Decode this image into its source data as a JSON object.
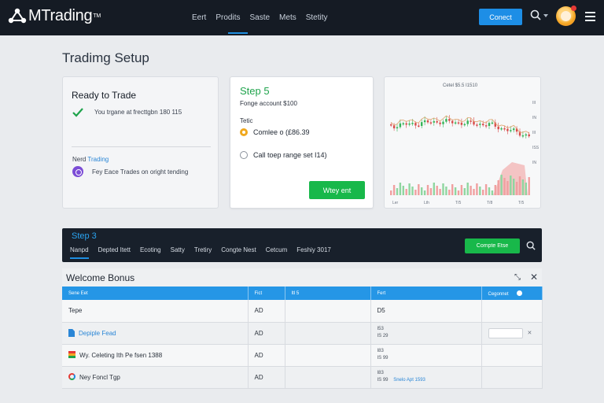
{
  "app": {
    "logo_text": "MTrading",
    "logo_tm": "TM",
    "nav": [
      {
        "label": "Eert",
        "active": false
      },
      {
        "label": "Prodits",
        "active": true
      },
      {
        "label": "Saste",
        "active": false
      },
      {
        "label": "Mets",
        "active": false
      },
      {
        "label": "Stetity",
        "active": false
      }
    ],
    "connect_label": "Conect",
    "accent": "#1d8ee6"
  },
  "page": {
    "title": "Tradimg Setup"
  },
  "ready_card": {
    "title": "Ready to Trade",
    "ready_text": "You trgane at frecttgbn 180 115",
    "next_prefix": "Nerd",
    "next_link": "Trading",
    "info_text": "Fey Eace Trades on oright tending"
  },
  "step5_card": {
    "step_label": "Step 5",
    "account_text": "Fonge account $100",
    "field_label": "Tetic",
    "option1": "Comlee o (£86.39",
    "option2": "Call toep range set I14)",
    "button_label": "Wtey ent",
    "color": "#1ea34b"
  },
  "chart_card": {
    "title": "Cetel $5.5 I1510"
  },
  "chart_data": {
    "type": "candlestick",
    "title": "Cetel $5.5 I1510",
    "x_tick_labels": [
      "Ler",
      "Lth",
      "T/5",
      "T/8",
      "T/5"
    ],
    "y_tick_labels": [
      "III",
      "IN",
      "III",
      "ISS",
      "IN"
    ],
    "colors": {
      "up": "#35b457",
      "down": "#d84b4b",
      "ma_line": "#e0a36c",
      "volume_up": "#8fd6a0",
      "volume_down": "#f0a0a0"
    }
  },
  "step3_bar": {
    "step_label": "Step 3",
    "tabs": [
      {
        "label": "Nanpd",
        "active": true
      },
      {
        "label": "Depted Itett",
        "active": false
      },
      {
        "label": "Ecoting",
        "active": false
      },
      {
        "label": "Satty",
        "active": false
      },
      {
        "label": "Tretiry",
        "active": false
      },
      {
        "label": "Congte Nest",
        "active": false
      },
      {
        "label": "Cetcum",
        "active": false
      },
      {
        "label": "Feshiy 3017",
        "active": false
      }
    ],
    "confirm_label": "Compte Etse"
  },
  "bonus_panel": {
    "title": "Welcome Bonus",
    "columns": [
      "Sene Eet",
      "Fict",
      "Itl 5",
      "Fert",
      "Cegonnet"
    ],
    "rows": [
      {
        "name": "Tepe",
        "col2": "AD",
        "col4": "D5",
        "col4_sub": []
      },
      {
        "name": "Depiple Fead",
        "col2": "AD",
        "col4": "I53",
        "col4_sub": [
          "IS 29"
        ]
      },
      {
        "name": "Wy. Celeting Ith Pe fsen 1388",
        "col2": "AD",
        "col4": "I83",
        "col4_sub": [
          "IS 99"
        ]
      },
      {
        "name": "Ney Foncl Tgp",
        "col2": "AD",
        "col4": "I83",
        "col4_sub": [
          "IS 99"
        ],
        "col4_link": "Snelo Apt 1593"
      }
    ]
  }
}
